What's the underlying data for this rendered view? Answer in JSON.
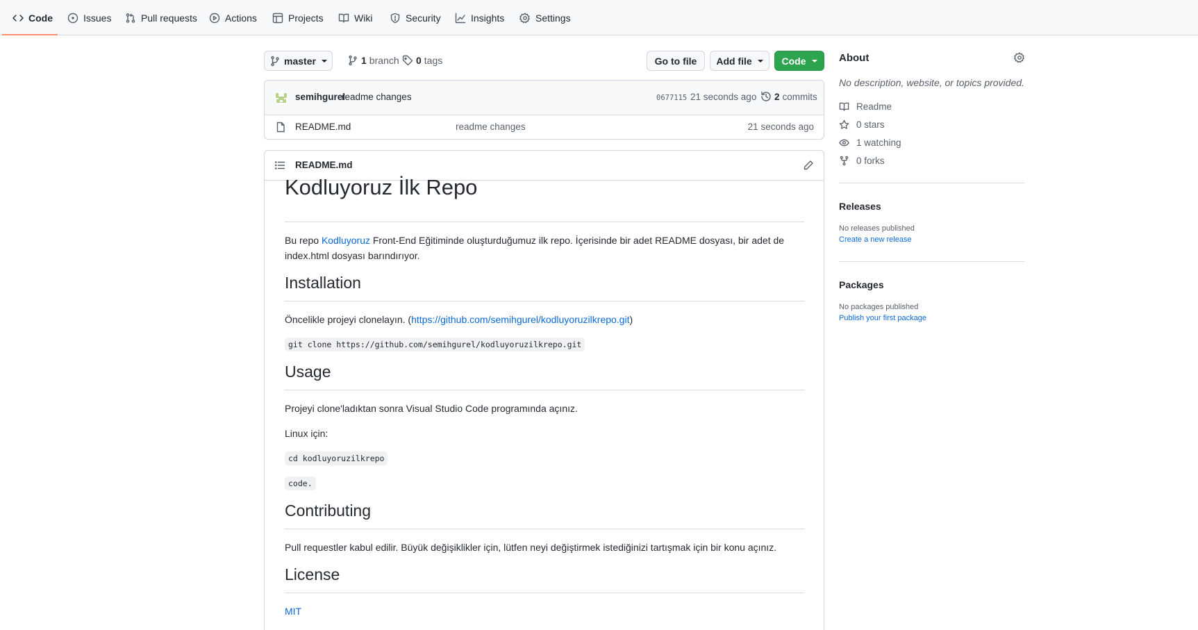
{
  "nav": {
    "tabs": [
      {
        "label": "Code",
        "icon": "code-icon"
      },
      {
        "label": "Issues",
        "icon": "issue-opened-icon"
      },
      {
        "label": "Pull requests",
        "icon": "git-pull-request-icon"
      },
      {
        "label": "Actions",
        "icon": "play-icon"
      },
      {
        "label": "Projects",
        "icon": "table-icon"
      },
      {
        "label": "Wiki",
        "icon": "book-icon"
      },
      {
        "label": "Security",
        "icon": "shield-icon"
      },
      {
        "label": "Insights",
        "icon": "graph-icon"
      },
      {
        "label": "Settings",
        "icon": "gear-icon"
      }
    ],
    "active_tab": "Code",
    "accent_color": "#fd8c73"
  },
  "toolbar": {
    "branch": "master",
    "branch_count": "1",
    "branch_label": "branch",
    "tag_count": "0",
    "tag_label": "tags",
    "go_to_file": "Go to file",
    "add_file": "Add file",
    "code": "Code",
    "code_button_color": "#2da44e"
  },
  "commit": {
    "author": "semihgurel",
    "message": "readme changes",
    "sha": "0677115",
    "time": "21 seconds ago",
    "commit_count": "2",
    "commit_label": "commits"
  },
  "files": [
    {
      "name": "README.md",
      "message": "readme changes",
      "time": "21 seconds ago",
      "icon": "file-icon"
    }
  ],
  "readme": {
    "filename": "README.md",
    "title": "Kodluyoruz İlk Repo",
    "intro_before": "Bu repo ",
    "intro_link": "Kodluyoruz",
    "intro_after_line1": " Front-End Eğitiminde oluşturduğumuz ilk repo. İçerisinde bir adet README dosyası, bir adet de",
    "intro_line2": "index.html dosyası barındırıyor.",
    "installation_heading": "Installation",
    "installation_text_before": "Öncelikle projeyi clonelayın. (",
    "installation_link": "https://github.com/semihgurel/kodluyoruzilkrepo.git",
    "installation_text_after": ")",
    "installation_code": "git clone https://github.com/semihgurel/kodluyoruzilkrepo.git",
    "usage_heading": "Usage",
    "usage_text": "Projeyi clone'ladıktan sonra Visual Studio Code programında açınız.",
    "usage_linux": "Linux için:",
    "usage_code1": "cd kodluyoruzilkrepo",
    "usage_code2": "code.",
    "contributing_heading": "Contributing",
    "contributing_text": "Pull requestler kabul edilir. Büyük değişiklikler için, lütfen neyi değiştirmek istediğinizi tartışmak için bir konu açınız.",
    "license_heading": "License",
    "license_link": "MIT"
  },
  "about": {
    "title": "About",
    "description": "No description, website, or topics provided.",
    "readme": "Readme",
    "stars": "0 stars",
    "watching": "1 watching",
    "forks": "0 forks"
  },
  "releases": {
    "title": "Releases",
    "none": "No releases published",
    "create": "Create a new release"
  },
  "packages": {
    "title": "Packages",
    "none": "No packages published",
    "publish": "Publish your first package"
  }
}
